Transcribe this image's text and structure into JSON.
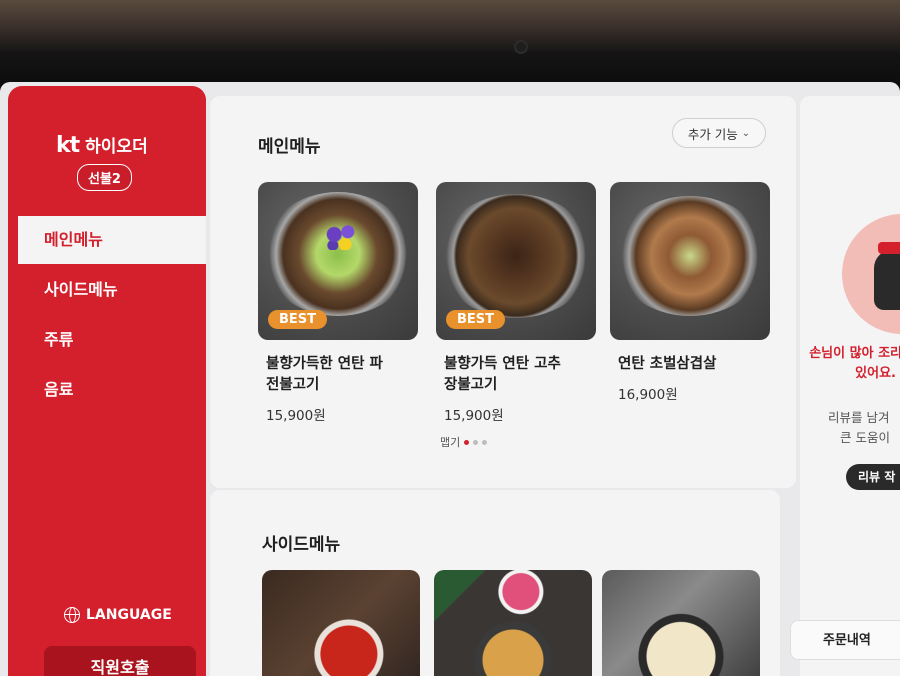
{
  "brand": {
    "logo_kt": "kt",
    "logo_name": "하이오더",
    "table_label": "선불2"
  },
  "sidebar": {
    "items": [
      {
        "label": "메인메뉴",
        "active": true
      },
      {
        "label": "사이드메뉴",
        "active": false
      },
      {
        "label": "주류",
        "active": false
      },
      {
        "label": "음료",
        "active": false
      }
    ],
    "language_label": "LANGUAGE",
    "language_icon": "globe-icon",
    "call_staff_label": "직원호출"
  },
  "main": {
    "title": "메인메뉴",
    "extra_button": "추가 기능",
    "items": [
      {
        "badge": "BEST",
        "name_line1": "불향가득한 연탄 파",
        "name_line2": "전불고기",
        "price": "15,900원"
      },
      {
        "badge": "BEST",
        "name_line1": "불향가득 연탄 고추",
        "name_line2": "장불고기",
        "price": "15,900원",
        "spicy_label": "맵기",
        "spicy_level": 1,
        "spicy_max": 3
      },
      {
        "name_line1": "연탄 초벌삼겹살",
        "price": "16,900원"
      }
    ]
  },
  "side": {
    "title": "사이드메뉴"
  },
  "right_panel": {
    "notice_red_line1": "손님이 많아 조리",
    "notice_red_line2": "있어요.",
    "notice_gray_line1": "리뷰를 남겨",
    "notice_gray_line2": "큰 도움이",
    "review_button": "리뷰 작",
    "order_history_button": "주문내역"
  },
  "colors": {
    "brand_red": "#d4202d",
    "badge_orange": "#e8912d",
    "dark_button": "#a8131d"
  }
}
